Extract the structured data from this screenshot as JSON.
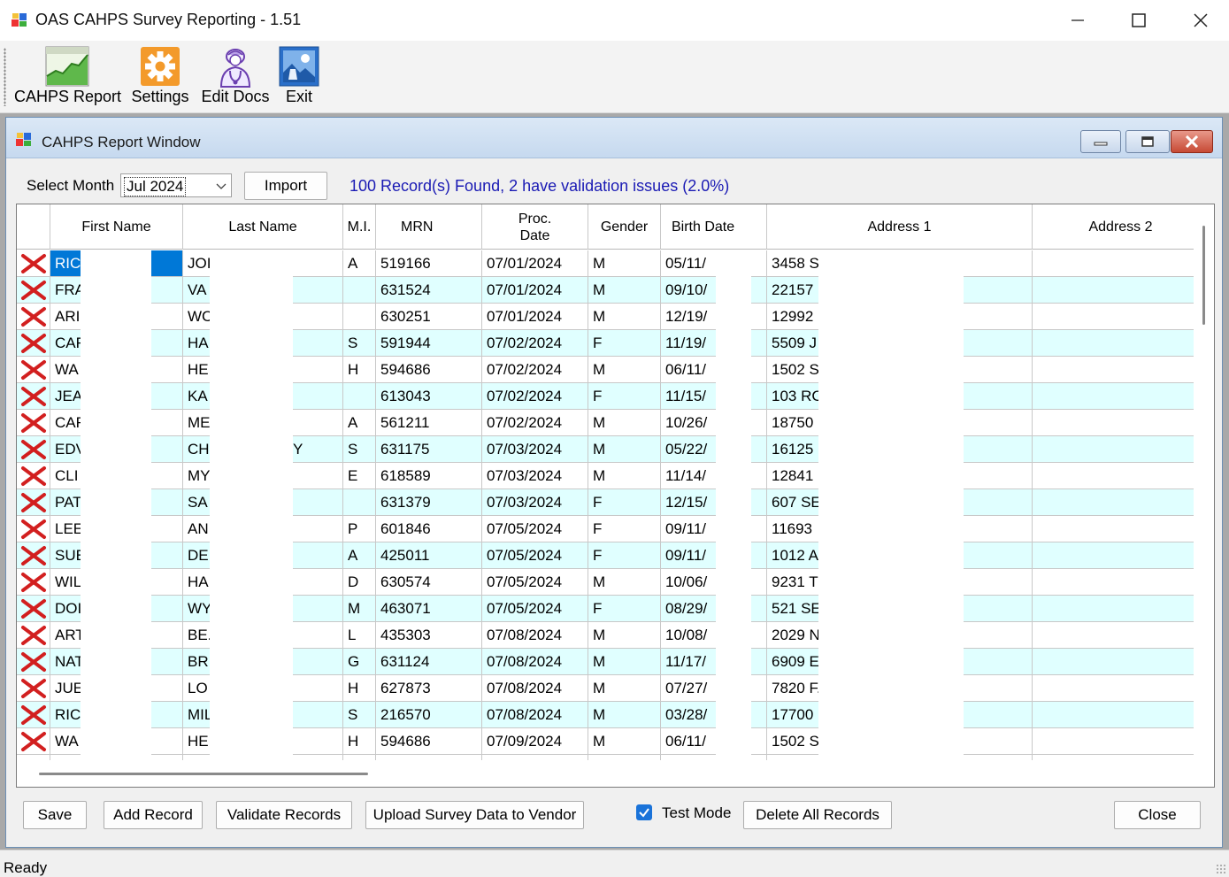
{
  "window": {
    "title": "OAS CAHPS Survey Reporting - 1.51",
    "minimize_icon": "minimize-icon",
    "maximize_icon": "maximize-icon",
    "close_icon": "close-icon"
  },
  "toolbar": {
    "items": [
      {
        "label": "CAHPS Report",
        "icon": "chart-icon"
      },
      {
        "label": "Settings",
        "icon": "gear-icon"
      },
      {
        "label": "Edit Docs",
        "icon": "doctor-icon"
      },
      {
        "label": "Exit",
        "icon": "picture-icon"
      }
    ]
  },
  "report_window": {
    "title": "CAHPS Report Window",
    "select_month_label": "Select Month",
    "selected_month": "Jul 2024",
    "import_label": "Import",
    "status_message": "100 Record(s) Found, 2 have validation issues (2.0%)",
    "grid": {
      "columns": [
        "",
        "First Name",
        "Last Name",
        "M.I.",
        "MRN",
        "Proc. Date",
        "Gender",
        "Birth Date",
        "Address 1",
        "Address 2"
      ],
      "rows": [
        {
          "first": "RIC",
          "last": "JOI",
          "extra": "",
          "mi": "A",
          "mrn": "519166",
          "proc": "07/01/2024",
          "gender": "M",
          "birth": "05/11/",
          "addr1": "3458 S",
          "addr2": ""
        },
        {
          "first": "FRA",
          "last": "VA",
          "extra": "",
          "mi": "",
          "mrn": "631524",
          "proc": "07/01/2024",
          "gender": "M",
          "birth": "09/10/",
          "addr1": "22157",
          "addr2": ""
        },
        {
          "first": "ARI",
          "last": "WC",
          "extra": "",
          "mi": "",
          "mrn": "630251",
          "proc": "07/01/2024",
          "gender": "M",
          "birth": "12/19/",
          "addr1": "12992",
          "addr2": ""
        },
        {
          "first": "CAF",
          "last": "HA",
          "extra": "",
          "mi": "S",
          "mrn": "591944",
          "proc": "07/02/2024",
          "gender": "F",
          "birth": "11/19/",
          "addr1": "5509 J",
          "addr2": ""
        },
        {
          "first": "WA",
          "last": "HE",
          "extra": "",
          "mi": "H",
          "mrn": "594686",
          "proc": "07/02/2024",
          "gender": "M",
          "birth": "06/11/",
          "addr1": "1502 S",
          "addr2": ""
        },
        {
          "first": "JEA",
          "last": "KA",
          "extra": "",
          "mi": "",
          "mrn": "613043",
          "proc": "07/02/2024",
          "gender": "F",
          "birth": "11/15/",
          "addr1": "103 RC",
          "addr2": ""
        },
        {
          "first": "CAF",
          "last": "ME",
          "extra": "",
          "mi": "A",
          "mrn": "561211",
          "proc": "07/02/2024",
          "gender": "M",
          "birth": "10/26/",
          "addr1": "18750",
          "addr2": ""
        },
        {
          "first": "EDV",
          "last": "CH",
          "extra": "Y",
          "mi": "S",
          "mrn": "631175",
          "proc": "07/03/2024",
          "gender": "M",
          "birth": "05/22/",
          "addr1": "16125",
          "addr2": ""
        },
        {
          "first": "CLI",
          "last": "MY",
          "extra": "",
          "mi": "E",
          "mrn": "618589",
          "proc": "07/03/2024",
          "gender": "M",
          "birth": "11/14/",
          "addr1": "12841",
          "addr2": ""
        },
        {
          "first": "PAT",
          "last": "SA",
          "extra": "",
          "mi": "",
          "mrn": "631379",
          "proc": "07/03/2024",
          "gender": "F",
          "birth": "12/15/",
          "addr1": "607 SE",
          "addr2": ""
        },
        {
          "first": "LEE",
          "last": "AN",
          "extra": "",
          "mi": "P",
          "mrn": "601846",
          "proc": "07/05/2024",
          "gender": "F",
          "birth": "09/11/",
          "addr1": "11693",
          "addr2": ""
        },
        {
          "first": "SUE",
          "last": "DE",
          "extra": "",
          "mi": "A",
          "mrn": "425011",
          "proc": "07/05/2024",
          "gender": "F",
          "birth": "09/11/",
          "addr1": "1012 A",
          "addr2": ""
        },
        {
          "first": "WIL",
          "last": "HA",
          "extra": "",
          "mi": "D",
          "mrn": "630574",
          "proc": "07/05/2024",
          "gender": "M",
          "birth": "10/06/",
          "addr1": "9231 T",
          "addr2": ""
        },
        {
          "first": "DOI",
          "last": "WY",
          "extra": "",
          "mi": "M",
          "mrn": "463071",
          "proc": "07/05/2024",
          "gender": "F",
          "birth": "08/29/",
          "addr1": "521 SE",
          "addr2": ""
        },
        {
          "first": "ART",
          "last": "BE.",
          "extra": "",
          "mi": "L",
          "mrn": "435303",
          "proc": "07/08/2024",
          "gender": "M",
          "birth": "10/08/",
          "addr1": "2029 N",
          "addr2": ""
        },
        {
          "first": "NAT",
          "last": "BR",
          "extra": "",
          "mi": "G",
          "mrn": "631124",
          "proc": "07/08/2024",
          "gender": "M",
          "birth": "11/17/",
          "addr1": "6909 E",
          "addr2": ""
        },
        {
          "first": "JUE",
          "last": "LO",
          "extra": "",
          "mi": "H",
          "mrn": "627873",
          "proc": "07/08/2024",
          "gender": "M",
          "birth": "07/27/",
          "addr1": "7820 F.",
          "addr2": ""
        },
        {
          "first": "RIC",
          "last": "MIL",
          "extra": "",
          "mi": "S",
          "mrn": "216570",
          "proc": "07/08/2024",
          "gender": "M",
          "birth": "03/28/",
          "addr1": "17700",
          "addr2": ""
        },
        {
          "first": "WA",
          "last": "HE",
          "extra": "",
          "mi": "H",
          "mrn": "594686",
          "proc": "07/09/2024",
          "gender": "M",
          "birth": "06/11/",
          "addr1": "1502 S",
          "addr2": ""
        }
      ]
    },
    "buttons": {
      "save": "Save",
      "add_record": "Add Record",
      "validate": "Validate Records",
      "upload": "Upload Survey Data to Vendor",
      "test_mode": "Test Mode",
      "delete_all": "Delete All Records",
      "close": "Close"
    },
    "test_mode_checked": true
  },
  "statusbar": {
    "text": "Ready"
  }
}
